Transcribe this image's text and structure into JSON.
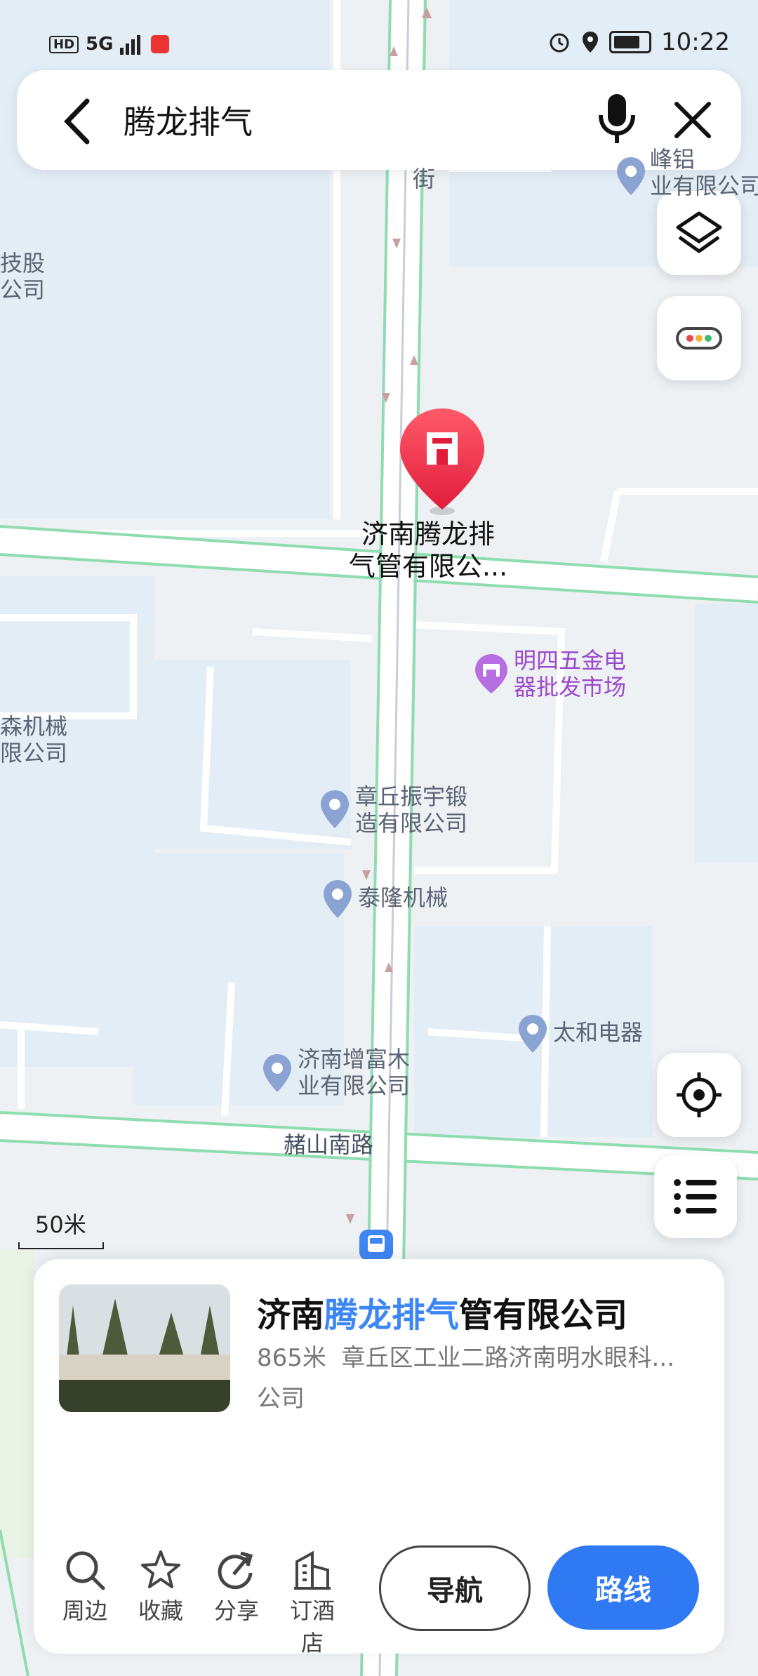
{
  "status": {
    "left_tag": "HD",
    "network": "5G",
    "time": "10:22"
  },
  "search": {
    "query": "腾龙排气"
  },
  "map": {
    "labels": {
      "top_left_company": "技股\n公司",
      "top_right_company": "峰铝\n业有限公司",
      "street_char": "街",
      "left_company": "森机械\n限公司",
      "purple_poi": "明四五金电\n器批发市场",
      "poi_zhangqiu": "章丘振宇锻\n造有限公司",
      "poi_tailong": "泰隆机械",
      "poi_taihe": "太和电器",
      "poi_zengfu": "济南增富木\n业有限公司",
      "road_zhushan": "赭山南路",
      "selected_poi": "济南腾龙排\n气管有限公..."
    }
  },
  "scale": {
    "label": "50米"
  },
  "card": {
    "title_prefix": "济南",
    "title_highlight": "腾龙排气",
    "title_suffix": "管有限公司",
    "distance": "865米",
    "address": "章丘区工业二路济南明水眼科...",
    "category": "公司",
    "actions": [
      "周边",
      "收藏",
      "分享",
      "订酒店"
    ],
    "nav_label": "导航",
    "route_label": "路线"
  }
}
